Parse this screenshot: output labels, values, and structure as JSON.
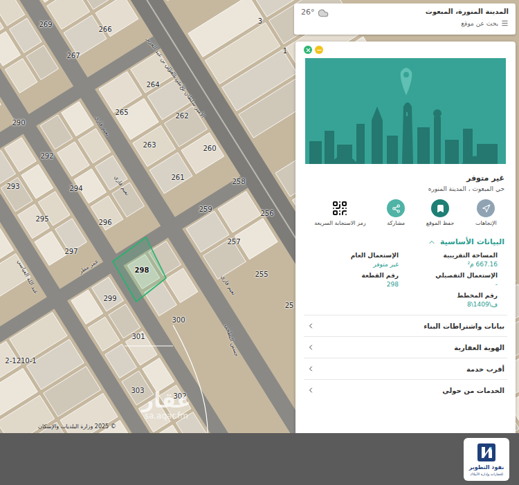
{
  "header": {
    "title": "المدينة المنورة، المبعوث",
    "search_placeholder": "بحث عن موقع",
    "temperature": "26°"
  },
  "map": {
    "parcels": [
      {
        "label": "269",
        "selected": false
      },
      {
        "label": "266",
        "selected": false
      },
      {
        "label": "267",
        "selected": false
      },
      {
        "label": "264",
        "selected": false
      },
      {
        "label": "265",
        "selected": false
      },
      {
        "label": "262",
        "selected": false
      },
      {
        "label": "263",
        "selected": false
      },
      {
        "label": "260",
        "selected": false
      },
      {
        "label": "261",
        "selected": false
      },
      {
        "label": "258",
        "selected": false
      },
      {
        "label": "259",
        "selected": false
      },
      {
        "label": "256",
        "selected": false
      },
      {
        "label": "257",
        "selected": false
      },
      {
        "label": "255",
        "selected": false
      },
      {
        "label": "25",
        "selected": false
      },
      {
        "label": "290",
        "selected": false
      },
      {
        "label": "292",
        "selected": false
      },
      {
        "label": "293",
        "selected": false
      },
      {
        "label": "294",
        "selected": false
      },
      {
        "label": "295",
        "selected": false
      },
      {
        "label": "296",
        "selected": false
      },
      {
        "label": "297",
        "selected": false
      },
      {
        "label": "298",
        "selected": true
      },
      {
        "label": "299",
        "selected": false
      },
      {
        "label": "300",
        "selected": false
      },
      {
        "label": "301",
        "selected": false
      },
      {
        "label": "302",
        "selected": false
      },
      {
        "label": "303",
        "selected": false
      },
      {
        "label": "1",
        "selected": false
      },
      {
        "label": "3",
        "selected": false
      },
      {
        "label": "2-1210-1",
        "selected": false
      }
    ],
    "streets": [
      {
        "label": "الأمير سلطان بن عبد العزيز"
      },
      {
        "label": "الأمير سلطان بن عبد العزيز"
      },
      {
        "label": "نعيم قاري"
      },
      {
        "label": "نعيم قاري"
      },
      {
        "label": "نعيم قاري"
      },
      {
        "label": "عمر مطر"
      },
      {
        "label": "عبد الله العباسي"
      },
      {
        "label": "حسين البطحي"
      }
    ],
    "watermark": {
      "name": "عقار",
      "url": "sa.aqar.fm"
    },
    "copyright": "© 2025 وزارة البلديات والإسكان"
  },
  "panel": {
    "title": "غير متوفر",
    "subtitle": "حي المبعوث ، المدينة المنوره",
    "actions": [
      {
        "label": "الإتجاهات",
        "kind": "directions"
      },
      {
        "label": "حفظ الموقع",
        "kind": "bookmark"
      },
      {
        "label": "مشاركة",
        "kind": "share"
      },
      {
        "label": "رمز الاستجابة السريعة",
        "kind": "qr"
      }
    ],
    "sections": [
      {
        "title": "البيانات الأساسية",
        "expanded": true,
        "fields": [
          {
            "label": "المساحة التقريبية",
            "value": "667.16 م²"
          },
          {
            "label": "الإستعمال العام",
            "value": "غير متوفر"
          },
          {
            "label": "الإستعمال التفصيلي",
            "value": "-"
          },
          {
            "label": "رقم القطعة",
            "value": "298"
          },
          {
            "label": "رقم المخطط",
            "value": "ف\\1409\\8"
          }
        ]
      },
      {
        "title": "بيانات واشتراطات البناء",
        "expanded": false,
        "fields": []
      },
      {
        "title": "الهوية العقارية",
        "expanded": false,
        "fields": []
      },
      {
        "title": "أقرب خدمة",
        "expanded": false,
        "fields": []
      },
      {
        "title": "الخدمات من حولي",
        "expanded": false,
        "fields": []
      }
    ]
  },
  "footer": {
    "brand": "نفوذ التطوير",
    "tagline": "للعقارات وإدارة الأملاك"
  }
}
